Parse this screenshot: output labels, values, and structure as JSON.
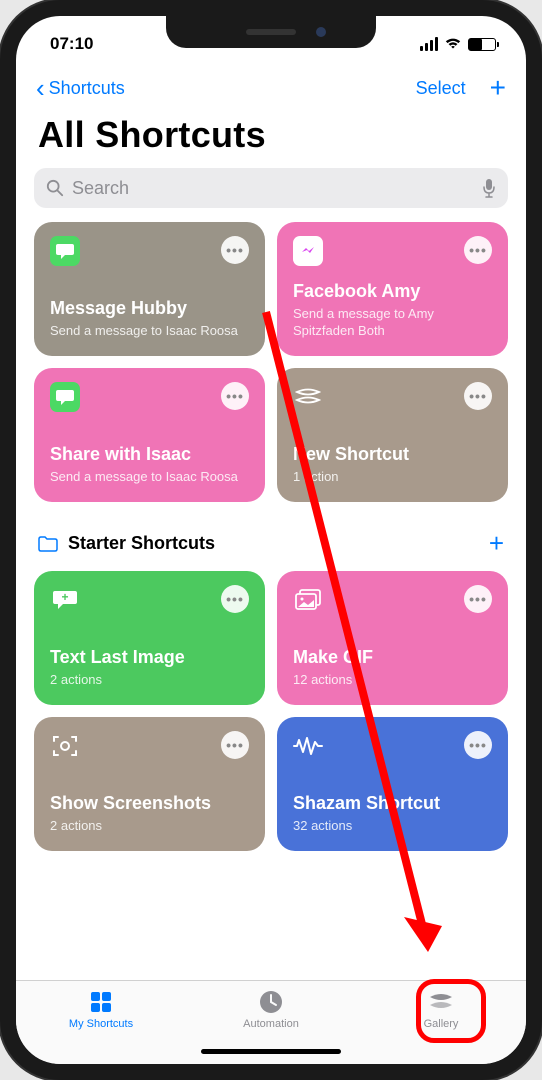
{
  "status": {
    "time": "07:10"
  },
  "nav": {
    "back_label": "Shortcuts",
    "select_label": "Select"
  },
  "page": {
    "title": "All Shortcuts"
  },
  "search": {
    "placeholder": "Search"
  },
  "shortcuts": [
    {
      "title": "Message Hubby",
      "subtitle": "Send a message to Isaac Roosa",
      "color": "c-taupe",
      "icon_name": "messages-icon",
      "icon_glyph": "💬",
      "icon_style": "icon-box-green"
    },
    {
      "title": "Facebook Amy",
      "subtitle": "Send a message to Amy Spitzfaden Both",
      "color": "c-pink",
      "icon_name": "messenger-icon",
      "icon_glyph": "⚡",
      "icon_style": "icon-box-white"
    },
    {
      "title": "Share with Isaac",
      "subtitle": "Send a message to Isaac Roosa",
      "color": "c-pink",
      "icon_name": "messages-icon",
      "icon_glyph": "💬",
      "icon_style": "icon-box-green"
    },
    {
      "title": "New Shortcut",
      "subtitle": "1 action",
      "color": "c-brown",
      "icon_name": "layers-icon",
      "icon_glyph": "≋",
      "icon_style": "icon-outline"
    }
  ],
  "section": {
    "title": "Starter Shortcuts"
  },
  "starter_shortcuts": [
    {
      "title": "Text Last Image",
      "subtitle": "2 actions",
      "color": "c-green",
      "icon_name": "message-plus-icon",
      "icon_glyph": "✚",
      "icon_style": "icon-outline"
    },
    {
      "title": "Make GIF",
      "subtitle": "12 actions",
      "color": "c-pink",
      "icon_name": "photos-icon",
      "icon_glyph": "🖻",
      "icon_style": "icon-outline"
    },
    {
      "title": "Show Screenshots",
      "subtitle": "2 actions",
      "color": "c-brown",
      "icon_name": "screenshot-icon",
      "icon_glyph": "⎙",
      "icon_style": "icon-outline"
    },
    {
      "title": "Shazam Shortcut",
      "subtitle": "32 actions",
      "color": "c-blue",
      "icon_name": "wave-icon",
      "icon_glyph": "〰",
      "icon_style": "icon-outline"
    }
  ],
  "tabs": {
    "my_shortcuts": "My Shortcuts",
    "automation": "Automation",
    "gallery": "Gallery"
  }
}
